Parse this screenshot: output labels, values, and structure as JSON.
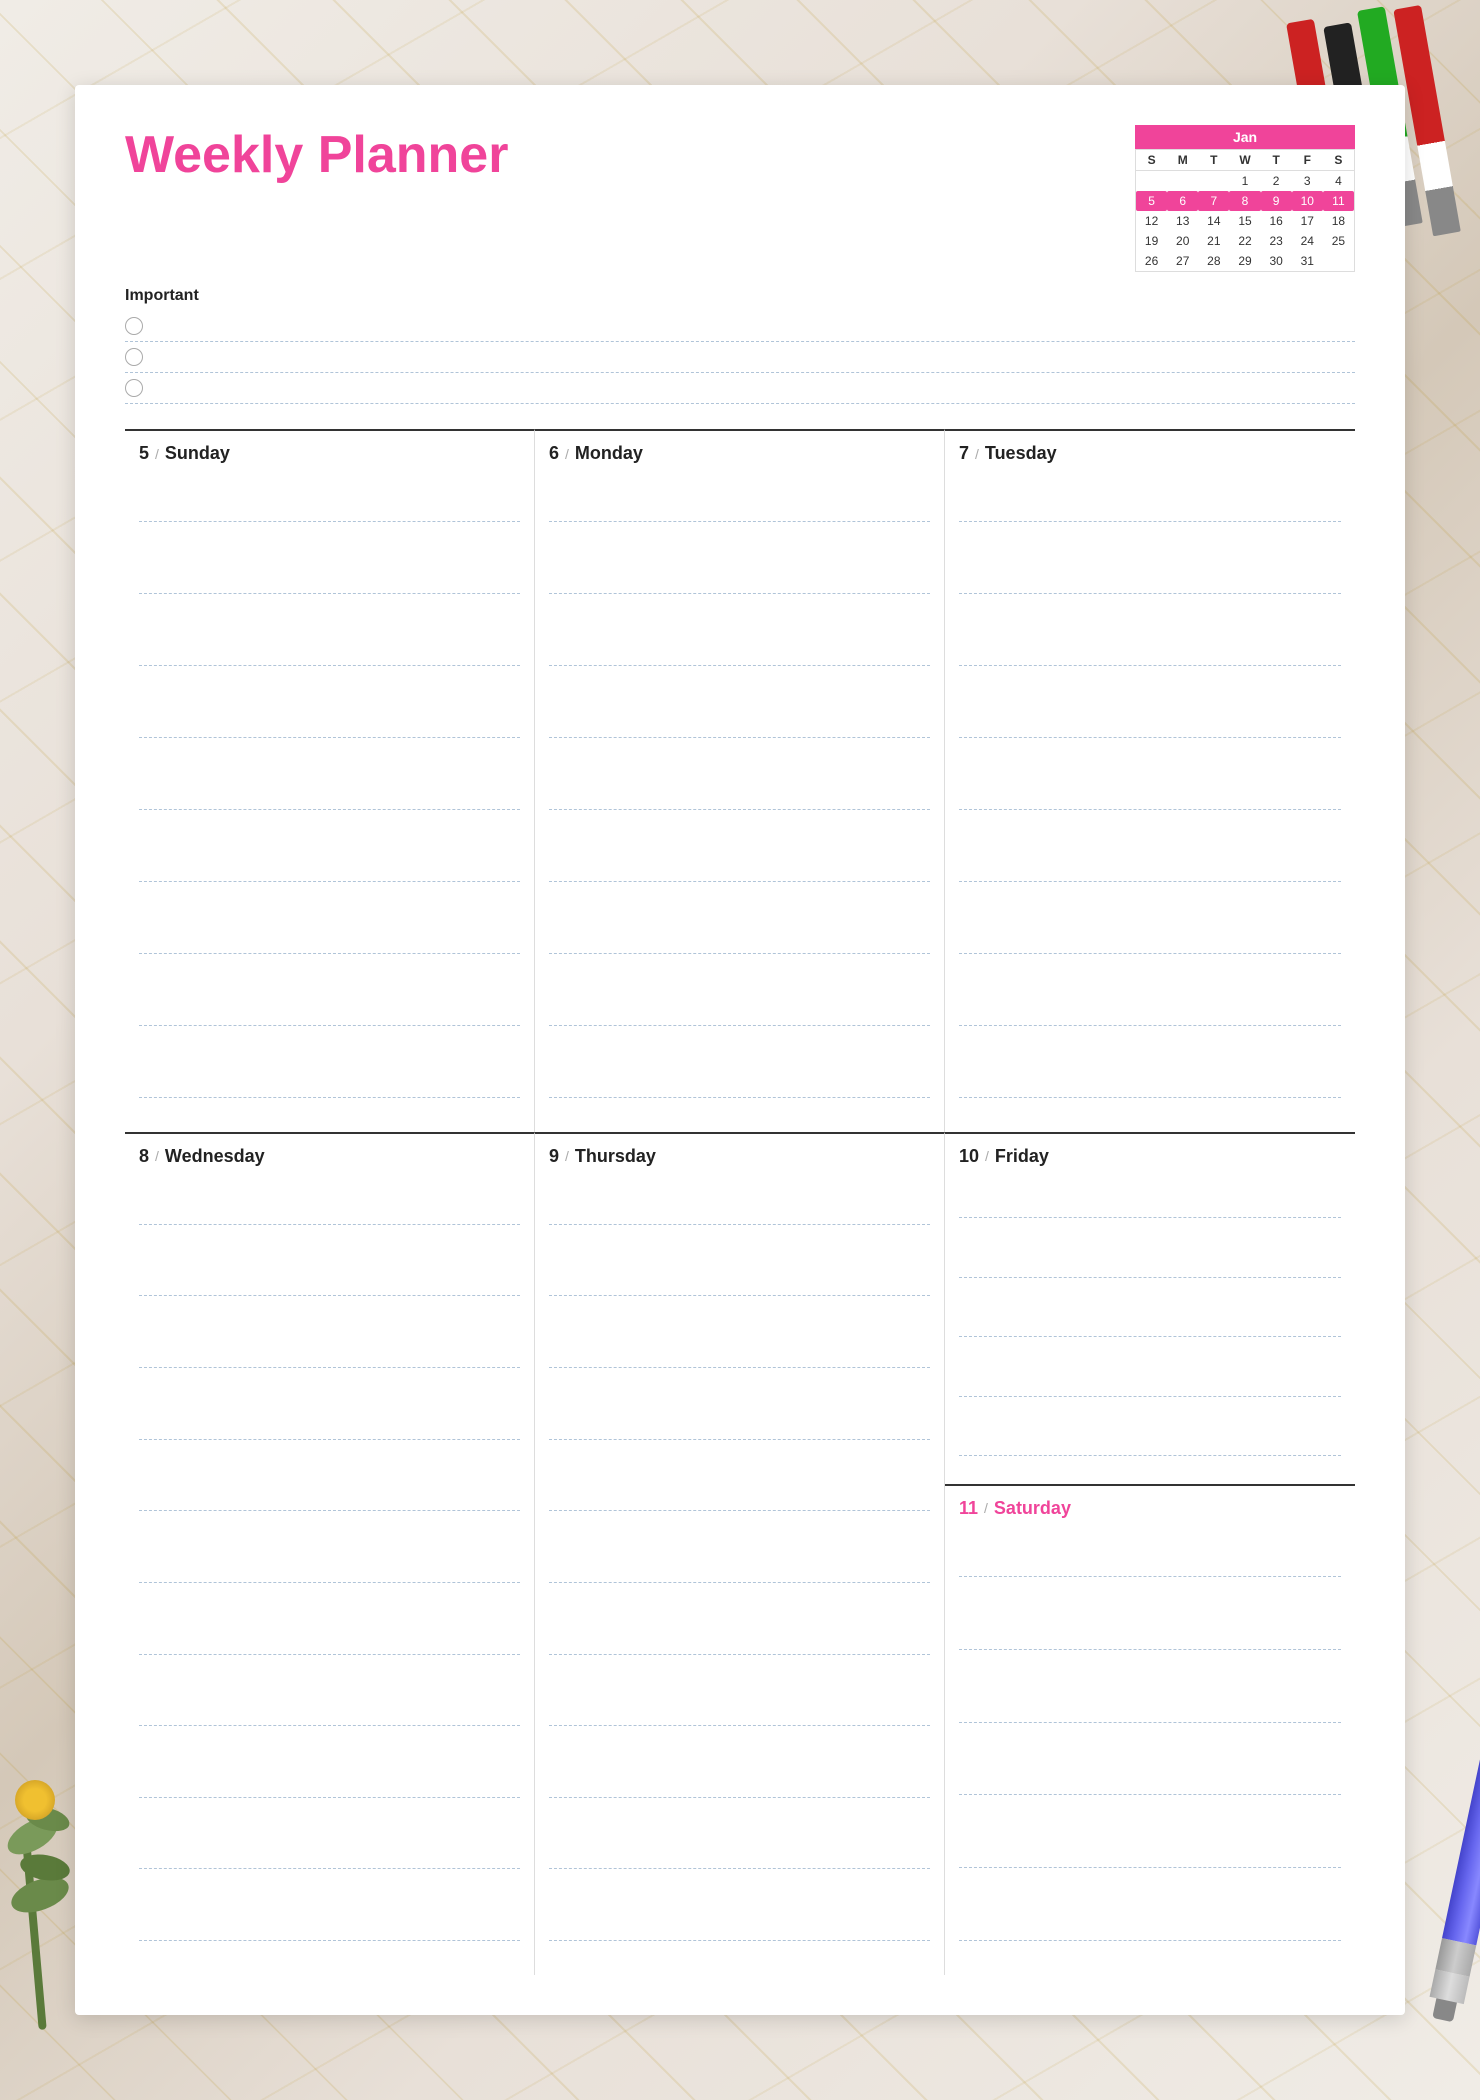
{
  "background": {
    "color": "#e8e0d8"
  },
  "planner": {
    "title": "Weekly Planner",
    "title_color": "#f0449a"
  },
  "mini_calendar": {
    "month": "Jan",
    "header_color": "#f0449a",
    "day_headers": [
      "S",
      "M",
      "T",
      "W",
      "T",
      "F",
      "S"
    ],
    "weeks": [
      [
        "",
        "",
        "",
        "1",
        "2",
        "3",
        "4"
      ],
      [
        "5",
        "6",
        "7",
        "8",
        "9",
        "10",
        "11"
      ],
      [
        "12",
        "13",
        "14",
        "15",
        "16",
        "17",
        "18"
      ],
      [
        "19",
        "20",
        "21",
        "22",
        "23",
        "24",
        "25"
      ],
      [
        "26",
        "27",
        "28",
        "29",
        "30",
        "31",
        ""
      ]
    ],
    "highlighted_days": [
      "5",
      "6",
      "7",
      "8",
      "9",
      "10",
      "11"
    ]
  },
  "important": {
    "label": "Important",
    "items": [
      {
        "id": 1
      },
      {
        "id": 2
      },
      {
        "id": 3
      }
    ]
  },
  "days": {
    "row1": [
      {
        "num": "5",
        "name": "Sunday",
        "saturday": false
      },
      {
        "num": "6",
        "name": "Monday",
        "saturday": false
      },
      {
        "num": "7",
        "name": "Tuesday",
        "saturday": false
      }
    ],
    "row2": [
      {
        "num": "8",
        "name": "Wednesday",
        "saturday": false
      },
      {
        "num": "9",
        "name": "Thursday",
        "saturday": false
      },
      {
        "num": "10",
        "name": "Friday",
        "saturday": false
      }
    ],
    "saturday": {
      "num": "11",
      "name": "Saturday",
      "saturday": true
    }
  },
  "lines_per_day": 10,
  "slash_char": "/"
}
